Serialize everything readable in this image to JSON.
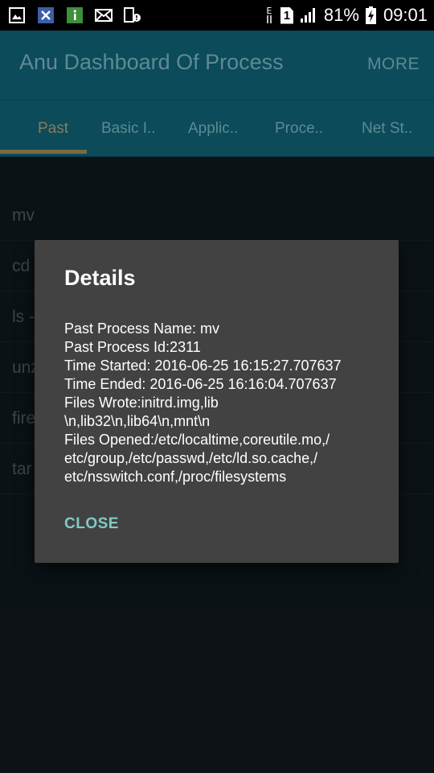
{
  "status_bar": {
    "battery": "81%",
    "time": "09:01",
    "sim_slot": "1",
    "network_type": "E",
    "icons": [
      "gallery-icon",
      "app-x-icon",
      "info-app-icon",
      "mail-icon",
      "device-alert-icon"
    ]
  },
  "app_bar": {
    "title": "Anu Dashboard Of Process",
    "more_label": "MORE"
  },
  "tabs": [
    {
      "label": "Past"
    },
    {
      "label": "Basic I.."
    },
    {
      "label": "Applic.."
    },
    {
      "label": "Proce.."
    },
    {
      "label": "Net St.."
    }
  ],
  "list": {
    "items": [
      "mv",
      "cd",
      "ls -",
      "unz",
      "fire",
      "tar"
    ]
  },
  "dialog": {
    "title": "Details",
    "lines": [
      "Past Process Name: mv",
      "Past Process Id:2311",
      "Time Started: 2016-06-25 16:15:27.707637",
      "Time Ended: 2016-06-25 16:16:04.707637",
      "Files Wrote:initrd.img,lib",
      "\\n,lib32\\n,lib64\\n,mnt\\n",
      "Files Opened:/etc/localtime,coreutile.mo,/",
      "etc/group,/etc/passwd,/etc/ld.so.cache,/",
      "etc/nsswitch.conf,/proc/filesystems"
    ],
    "close_label": "CLOSE"
  },
  "colors": {
    "app_bar": "#0b4b5a",
    "dialog_bg": "#424242",
    "accent": "#80cbc4",
    "tab_indicator": "#7a6a41"
  }
}
